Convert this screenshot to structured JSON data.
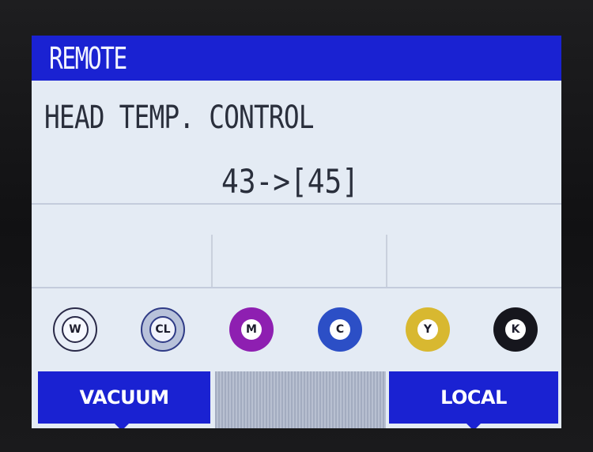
{
  "header": {
    "title": "REMOTE"
  },
  "main": {
    "heading": "HEAD TEMP. CONTROL",
    "temperature_text": "43->[45]",
    "current_temp": 43,
    "target_temp": 45
  },
  "inks": [
    {
      "id": "w",
      "label": "W",
      "ring_color": "#e8eef7"
    },
    {
      "id": "cl",
      "label": "CL",
      "ring_color": "#b8c2da"
    },
    {
      "id": "m",
      "label": "M",
      "ring_color": "#8e1fb1"
    },
    {
      "id": "c",
      "label": "C",
      "ring_color": "#2c4fc6"
    },
    {
      "id": "y",
      "label": "Y",
      "ring_color": "#d8b830"
    },
    {
      "id": "k",
      "label": "K",
      "ring_color": "#16161d"
    }
  ],
  "softkeys": {
    "left": "VACUUM",
    "right": "LOCAL"
  },
  "colors": {
    "accent": "#1a22d2",
    "screen_bg": "#e4ebf4"
  }
}
